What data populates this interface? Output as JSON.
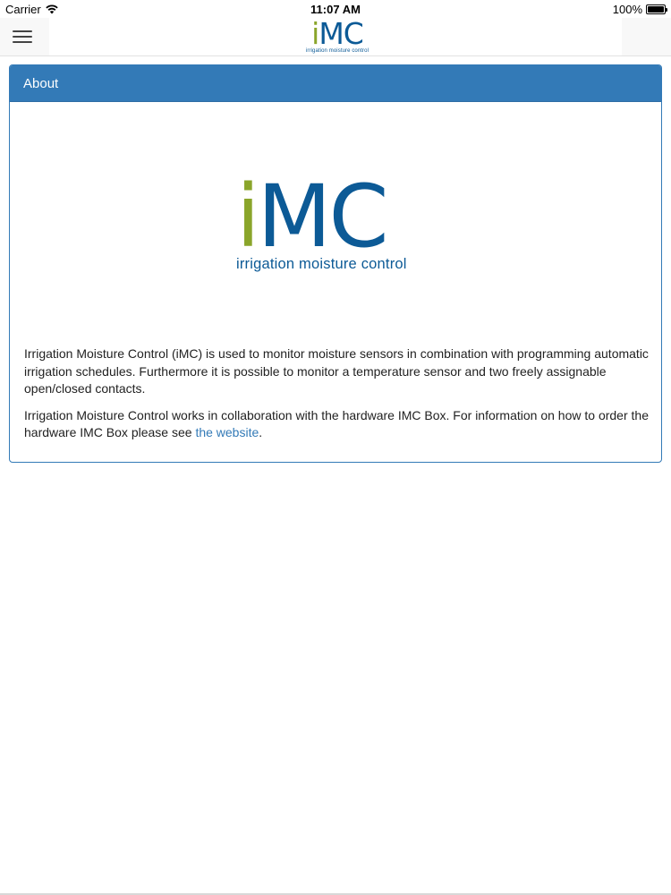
{
  "status_bar": {
    "carrier": "Carrier",
    "time": "11:07 AM",
    "battery": "100%",
    "battery_level": 1.0
  },
  "navbar": {
    "logo_i": "i",
    "logo_mc": "MC",
    "logo_tagline": "irrigation moisture control",
    "menu_icon": "hamburger-icon"
  },
  "panel": {
    "title": "About",
    "logo_i": "i",
    "logo_mc": "MC",
    "logo_tagline": "irrigation moisture control",
    "paragraph1": "Irrigation Moisture Control (iMC) is used to monitor moisture sensors in combination with programming automatic irrigation schedules. Furthermore it is possible to monitor a temperature sensor and two freely assignable open/closed contacts.",
    "paragraph2_before": "Irrigation Moisture Control works in collaboration with the hardware IMC Box. For information on how to order the hardware IMC Box please see ",
    "paragraph2_link": "the website",
    "paragraph2_after": "."
  },
  "colors": {
    "panel_primary": "#337ab7",
    "logo_green": "#8aa52a",
    "logo_blue": "#0c5a96"
  }
}
